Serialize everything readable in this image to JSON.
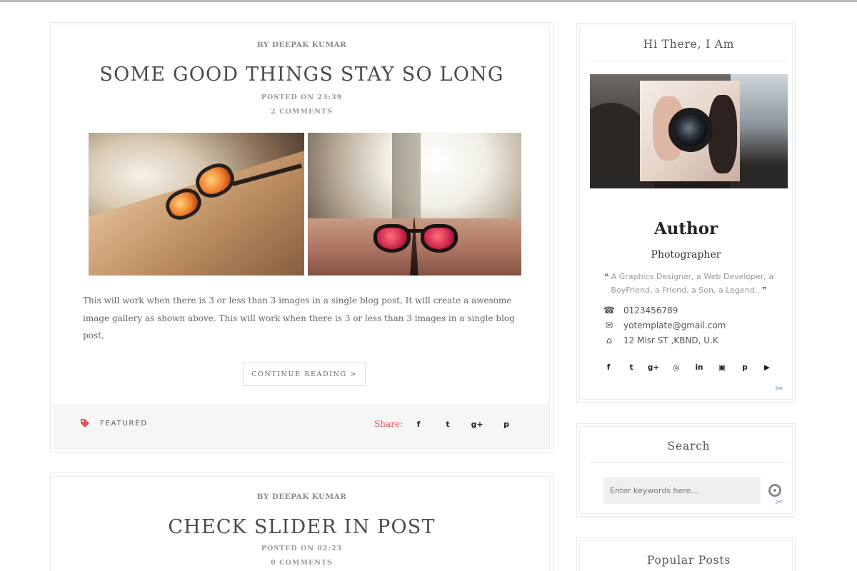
{
  "posts": [
    {
      "byline": "BY DEEPAK KUMAR",
      "title": "SOME GOOD THINGS STAY SO LONG",
      "posted": "POSTED ON 23:39",
      "comments": "2 COMMENTS",
      "excerpt": "This will work when there is 3 or less than 3 images in a single blog post, It will create a awesome image gallery as shown above. This will work when there is 3 or less than 3 images in a single blog post,",
      "continue_label": "CONTINUE READING >",
      "tag": "FEATURED",
      "share_label": "Share:",
      "share_icons": [
        "facebook-icon",
        "twitter-icon",
        "google-plus-icon",
        "pinterest-icon"
      ],
      "share_glyphs": [
        "f",
        "t",
        "g+",
        "p"
      ]
    },
    {
      "byline": "BY DEEPAK KUMAR",
      "title": "CHECK SLIDER IN POST",
      "posted": "POSTED ON 02:23",
      "comments": "0 COMMENTS"
    }
  ],
  "sidebar": {
    "author_widget": {
      "title": "Hi There, I Am",
      "name": "Author",
      "role": "Photographer",
      "bio": "A Graphics Designer, a Web Developer, a BoyFriend, a Friend, a Son, a Legend..",
      "phone": "0123456789",
      "email": "yotemplate@gmail.com",
      "address": "12 Misr ST ,KBND, U.K",
      "social_icons": [
        "facebook-icon",
        "twitter-icon",
        "google-plus-icon",
        "instagram-icon",
        "linkedin-icon",
        "flickr-icon",
        "pinterest-icon",
        "youtube-icon"
      ],
      "social_glyphs": [
        "f",
        "t",
        "g+",
        "◎",
        "in",
        "▣",
        "p",
        "▶"
      ]
    },
    "search_widget": {
      "title": "Search",
      "placeholder": "Enter keywords here..."
    },
    "popular_widget": {
      "title": "Popular Posts"
    }
  },
  "colors": {
    "accent": "#e0505b",
    "border": "#e8e8e8",
    "footer_bg": "#f6f6f6",
    "text": "#555555"
  }
}
